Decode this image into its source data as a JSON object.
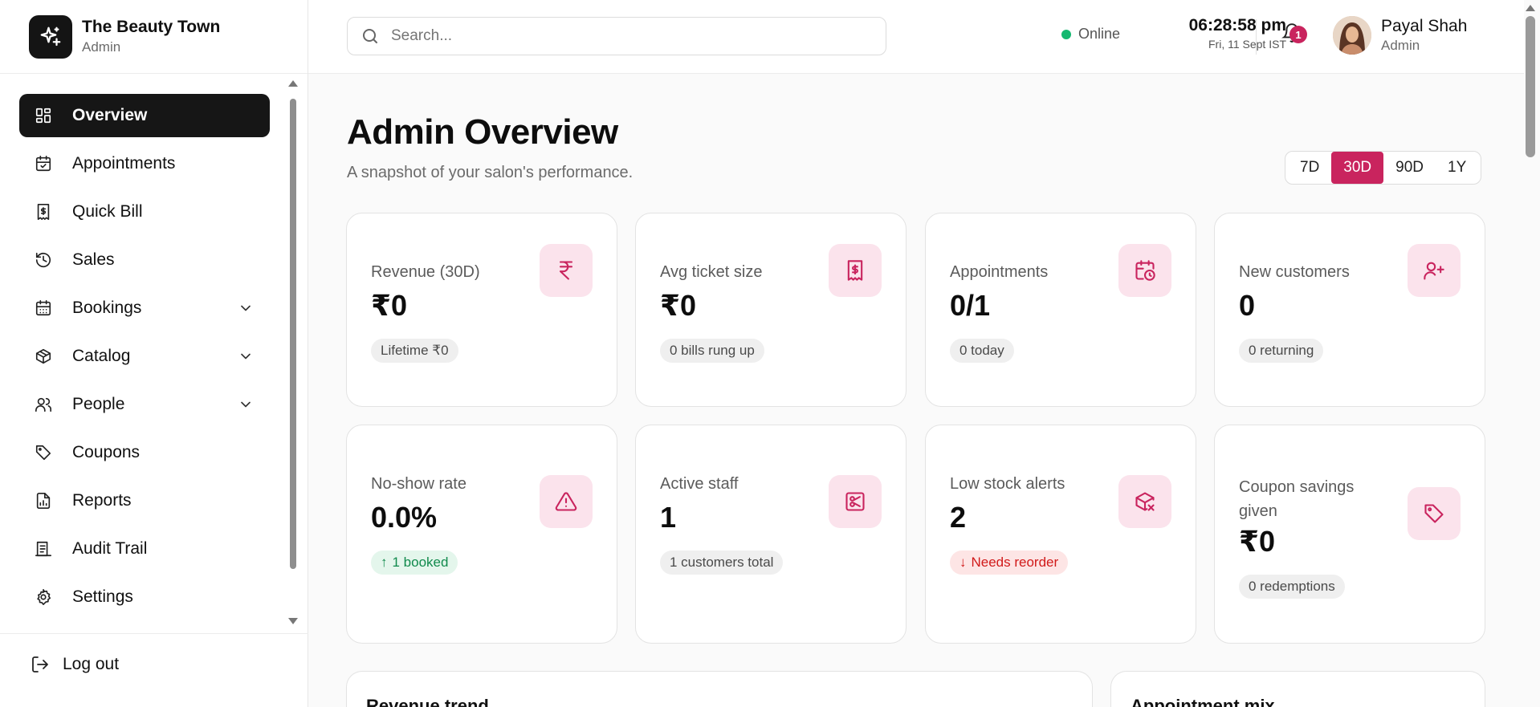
{
  "brand": {
    "title": "The Beauty Town",
    "subtitle": "Admin"
  },
  "sidebar": {
    "items": [
      {
        "label": "Overview",
        "icon": "grid-icon",
        "active": true
      },
      {
        "label": "Appointments",
        "icon": "calendar-check-icon"
      },
      {
        "label": "Quick Bill",
        "icon": "receipt-icon"
      },
      {
        "label": "Sales",
        "icon": "history-icon"
      },
      {
        "label": "Bookings",
        "icon": "calendar-icon",
        "expandable": true
      },
      {
        "label": "Catalog",
        "icon": "box-icon",
        "expandable": true
      },
      {
        "label": "People",
        "icon": "users-icon",
        "expandable": true
      },
      {
        "label": "Coupons",
        "icon": "tag-icon"
      },
      {
        "label": "Reports",
        "icon": "file-chart-icon"
      },
      {
        "label": "Audit Trail",
        "icon": "audit-icon"
      },
      {
        "label": "Settings",
        "icon": "gear-icon"
      }
    ],
    "logout_label": "Log out"
  },
  "topbar": {
    "search_placeholder": "Search...",
    "status": "Online",
    "time": "06:28:58 pm",
    "date": "Fri, 11 Sept IST",
    "notification_count": "1",
    "user_name": "Payal Shah",
    "user_role": "Admin"
  },
  "main": {
    "title": "Admin Overview",
    "subtitle": "A snapshot of your salon's performance.",
    "ranges": [
      "7D",
      "30D",
      "90D",
      "1Y"
    ],
    "selected_range": "30D",
    "cards": [
      {
        "label": "Revenue (30D)",
        "value": "₹0",
        "chip": "Lifetime ₹0",
        "icon": "rupee-icon"
      },
      {
        "label": "Avg ticket size",
        "value": "₹0",
        "chip": "0 bills rung up",
        "icon": "receipt-icon"
      },
      {
        "label": "Appointments",
        "value": "0/1",
        "chip": "0 today",
        "icon": "calendar-clock-icon"
      },
      {
        "label": "New customers",
        "value": "0",
        "chip": "0 returning",
        "icon": "user-plus-icon"
      },
      {
        "label": "No-show rate",
        "value": "0.0%",
        "chip": "1 booked",
        "icon": "alert-triangle-icon",
        "chip_tone": "up"
      },
      {
        "label": "Active staff",
        "value": "1",
        "chip": "1 customers total",
        "icon": "scissors-icon"
      },
      {
        "label": "Low stock alerts",
        "value": "2",
        "chip": "Needs reorder",
        "icon": "package-x-icon",
        "chip_tone": "down"
      },
      {
        "label": "Coupon savings given",
        "value": "₹0",
        "chip": "0 redemptions",
        "icon": "tag-icon"
      }
    ],
    "panels": [
      {
        "title": "Revenue trend"
      },
      {
        "title": "Appointment mix"
      }
    ]
  },
  "colors": {
    "accent": "#c9245e",
    "accent_soft": "#fbe3ec",
    "online": "#14b870",
    "nav_active": "#161616"
  }
}
